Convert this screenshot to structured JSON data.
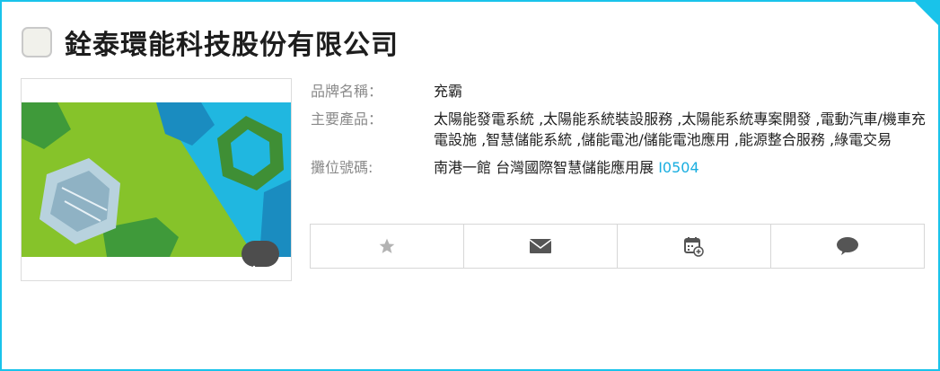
{
  "company": {
    "name": "銓泰環能科技股份有限公司"
  },
  "details": {
    "brand_label": "品牌名稱：",
    "brand_value": "充霸",
    "products_label": "主要產品：",
    "products_value": "太陽能發電系統 ,太陽能系統裝設服務 ,太陽能系統專案開發 ,電動汽車/機車充電設施 ,智慧儲能系統 ,儲能電池/儲能電池應用 ,能源整合服務 ,綠電交易",
    "booth_label": "攤位號碼:",
    "booth_location": "南港一館 台灣國際智慧儲能應用展",
    "booth_number": "I0504"
  },
  "actions": [
    {
      "icon": "star-icon"
    },
    {
      "icon": "mail-icon"
    },
    {
      "icon": "calendar-add-icon"
    },
    {
      "icon": "chat-bubble-icon"
    }
  ],
  "colors": {
    "accent": "#19c3ea",
    "booth_link": "#19aee0"
  }
}
